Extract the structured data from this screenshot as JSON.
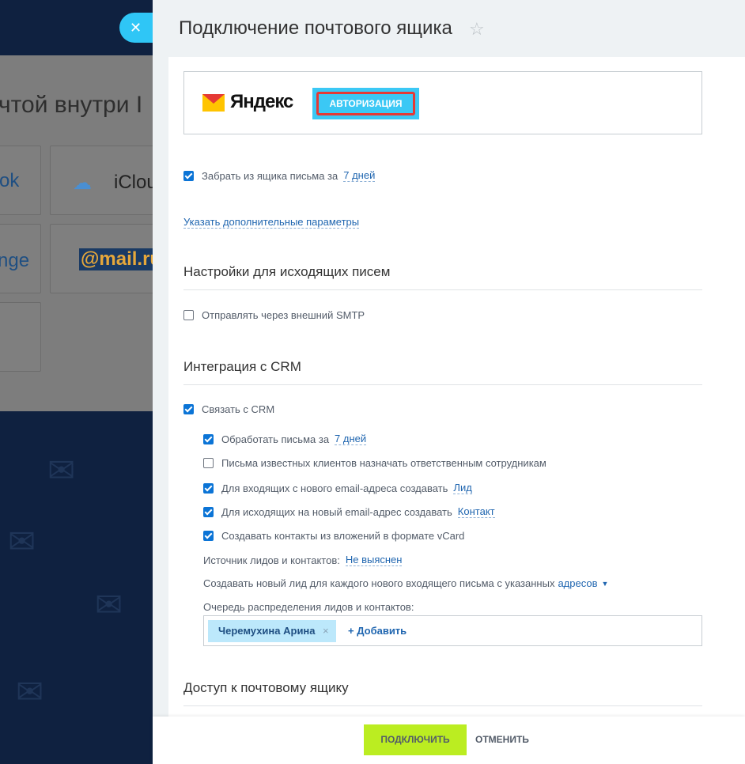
{
  "background": {
    "title_fragment": "чтой внутри I",
    "tiles": [
      {
        "label": "ok"
      },
      {
        "label": "iClou"
      },
      {
        "label": "nge"
      },
      {
        "label": "@mail.ru"
      }
    ],
    "close_glyph": "✕"
  },
  "slider": {
    "title": "Подключение почтового ящика",
    "star_glyph": "☆"
  },
  "provider": {
    "name": "Яндекс",
    "auth_label": "АВТОРИЗАЦИЯ"
  },
  "fetch": {
    "label": "Забрать из ящика письма за",
    "value": "7 дней",
    "checked": true
  },
  "extra_params_link": "Указать дополнительные параметры",
  "outgoing": {
    "heading": "Настройки для исходящих писем",
    "smtp_label": "Отправлять через внешний SMTP",
    "smtp_checked": false
  },
  "crm": {
    "heading": "Интеграция с CRM",
    "link_label": "Связать с CRM",
    "process_label": "Обработать письма за",
    "process_value": "7 дней",
    "known_clients_label": "Письма известных клиентов назначать ответственным сотрудникам",
    "incoming_label": "Для входящих с нового email-адреса создавать",
    "incoming_value": "Лид",
    "outgoing_label": "Для исходящих на новый email-адрес создавать",
    "outgoing_value": "Контакт",
    "vcard_label": "Создавать контакты из вложений в формате vCard",
    "source_label": "Источник лидов и контактов:",
    "source_value": "Не выяснен",
    "new_lead_label": "Создавать новый лид для каждого нового входящего письма с указанных",
    "new_lead_value": "адресов",
    "queue_label": "Очередь распределения лидов и контактов:",
    "queue_person": "Черемухина Арина",
    "queue_remove": "×",
    "add_label": "+ Добавить"
  },
  "access": {
    "heading": "Доступ к почтовому ящику"
  },
  "footer": {
    "connect_label": "ПОДКЛЮЧИТЬ",
    "cancel_label": "ОТМЕНИТЬ"
  },
  "colors": {
    "accent": "#2fc6f6",
    "link": "#2066b0",
    "checkbox": "#0b74d6",
    "primary_button": "#bbed21",
    "highlight": "#e53935"
  }
}
